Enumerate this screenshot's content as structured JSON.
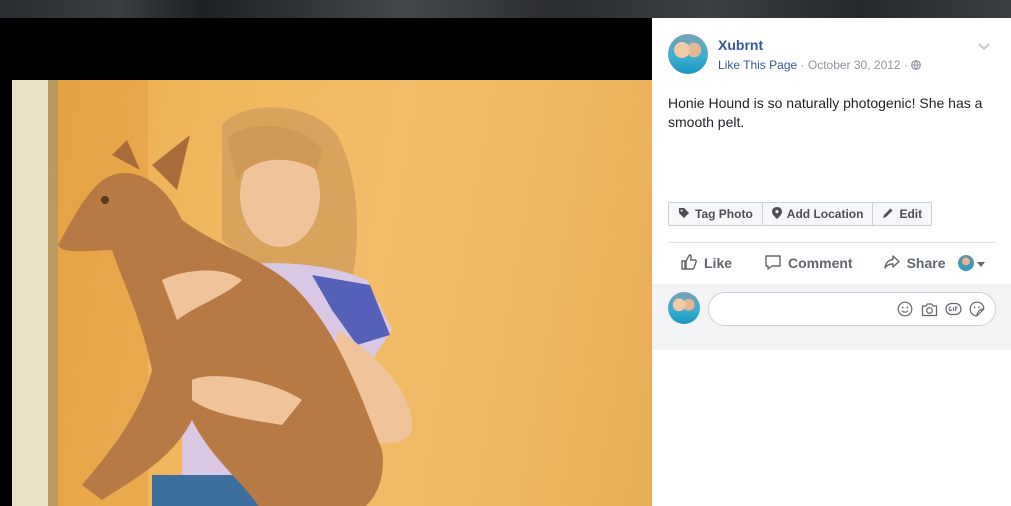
{
  "post": {
    "page_name": "Xubrnt",
    "like_link": "Like This Page",
    "separator": "·",
    "date": "October 30, 2012",
    "caption": "Honie Hound is so naturally photogenic! She has a smooth pelt."
  },
  "tag_bar": {
    "tag_photo": "Tag Photo",
    "add_location": "Add Location",
    "edit": "Edit"
  },
  "actions": {
    "like": "Like",
    "comment": "Comment",
    "share": "Share"
  },
  "comment": {
    "placeholder": ""
  },
  "colors": {
    "link_blue": "#365899",
    "meta_gray": "#90949c",
    "action_gray": "#606770",
    "photo_bg": "#f0b55a"
  },
  "icons": [
    "caret-down-icon",
    "globe-icon",
    "tag-icon",
    "location-pin-icon",
    "pencil-icon",
    "thumbs-up-icon",
    "comment-bubble-icon",
    "share-arrow-icon",
    "emoji-icon",
    "camera-icon",
    "gif-icon",
    "sticker-icon"
  ]
}
